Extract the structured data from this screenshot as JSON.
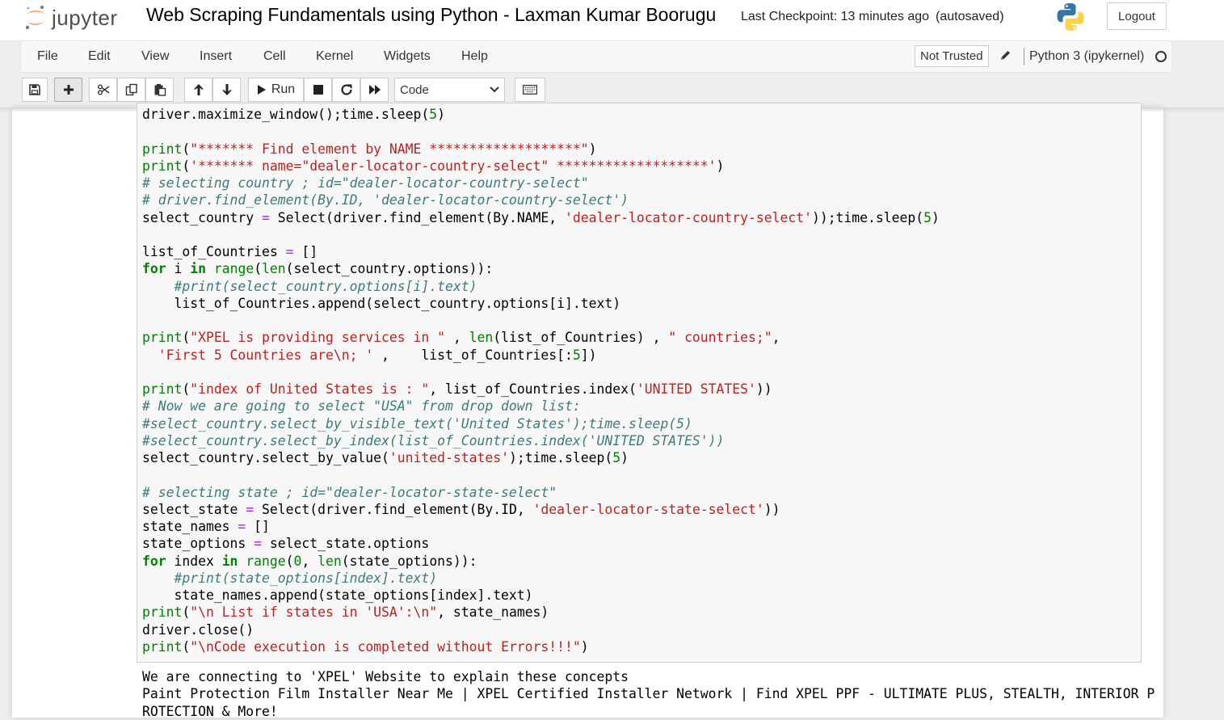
{
  "header": {
    "logo_text": "jupyter",
    "notebook_title": "Web Scraping Fundamentals using Python - Laxman Kumar Boorugu",
    "checkpoint": "Last Checkpoint: 13 minutes ago",
    "autosave": "(autosaved)",
    "logout_label": "Logout"
  },
  "menubar": {
    "items": [
      "File",
      "Edit",
      "View",
      "Insert",
      "Cell",
      "Kernel",
      "Widgets",
      "Help"
    ],
    "not_trusted_label": "Not Trusted",
    "kernel_name": "Python 3 (ipykernel)"
  },
  "toolbar": {
    "run_label": "Run",
    "cell_type": "Code",
    "icons": [
      "save-icon",
      "plus-icon",
      "scissors-icon",
      "copy-icon",
      "paste-icon",
      "arrow-up-icon",
      "arrow-down-icon",
      "step-forward-icon",
      "stop-icon",
      "restart-icon",
      "fast-forward-icon",
      "keyboard-icon"
    ]
  },
  "colors": {
    "keyword": "#008000",
    "string": "#ba2121",
    "comment": "#3d7b7b",
    "operator": "#aa22ff"
  },
  "cell": {
    "code_lines": [
      [
        [
          "n",
          "driver.maximize_window();time.sleep("
        ],
        [
          "num",
          "5"
        ],
        [
          "n",
          ")"
        ]
      ],
      [],
      [
        [
          "bi",
          "print"
        ],
        [
          "n",
          "("
        ],
        [
          "str",
          "\"******* Find element by NAME *******************\""
        ],
        [
          "n",
          ")"
        ]
      ],
      [
        [
          "bi",
          "print"
        ],
        [
          "n",
          "("
        ],
        [
          "str",
          "'******* name=\"dealer-locator-country-select\" *******************'"
        ],
        [
          "n",
          ")"
        ]
      ],
      [
        [
          "cm",
          "# selecting country ; id=\"dealer-locator-country-select\""
        ]
      ],
      [
        [
          "cm",
          "# driver.find_element(By.ID, 'dealer-locator-country-select')"
        ]
      ],
      [
        [
          "n",
          "select_country "
        ],
        [
          "op",
          "="
        ],
        [
          "n",
          " Select(driver.find_element(By.NAME, "
        ],
        [
          "str",
          "'dealer-locator-country-select'"
        ],
        [
          "n",
          "));time.sleep("
        ],
        [
          "num",
          "5"
        ],
        [
          "n",
          ")"
        ]
      ],
      [],
      [
        [
          "n",
          "list_of_Countries "
        ],
        [
          "op",
          "="
        ],
        [
          "n",
          " []"
        ]
      ],
      [
        [
          "kw",
          "for"
        ],
        [
          "n",
          " i "
        ],
        [
          "kw",
          "in"
        ],
        [
          "n",
          " "
        ],
        [
          "bi",
          "range"
        ],
        [
          "n",
          "("
        ],
        [
          "bi",
          "len"
        ],
        [
          "n",
          "(select_country.options)):"
        ]
      ],
      [
        [
          "n",
          "    "
        ],
        [
          "cm",
          "#print(select_country.options[i].text)"
        ]
      ],
      [
        [
          "n",
          "    list_of_Countries.append(select_country.options[i].text)"
        ]
      ],
      [],
      [
        [
          "bi",
          "print"
        ],
        [
          "n",
          "("
        ],
        [
          "str",
          "\"XPEL is providing services in \""
        ],
        [
          "n",
          " , "
        ],
        [
          "bi",
          "len"
        ],
        [
          "n",
          "(list_of_Countries) , "
        ],
        [
          "str",
          "\" countries;\""
        ],
        [
          "n",
          ","
        ]
      ],
      [
        [
          "n",
          "  "
        ],
        [
          "str",
          "'First 5 Countries are\\n; '"
        ],
        [
          "n",
          " ,    list_of_Countries[:"
        ],
        [
          "num",
          "5"
        ],
        [
          "n",
          "])"
        ]
      ],
      [],
      [
        [
          "bi",
          "print"
        ],
        [
          "n",
          "("
        ],
        [
          "str",
          "\"index of United States is : \""
        ],
        [
          "n",
          ", list_of_Countries.index("
        ],
        [
          "str",
          "'UNITED STATES'"
        ],
        [
          "n",
          "))"
        ]
      ],
      [
        [
          "cm",
          "# Now we are going to select \"USA\" from drop down list:"
        ]
      ],
      [
        [
          "cm",
          "#select_country.select_by_visible_text('United States');time.sleep(5)"
        ]
      ],
      [
        [
          "cm",
          "#select_country.select_by_index(list_of_Countries.index('UNITED STATES'))"
        ]
      ],
      [
        [
          "n",
          "select_country.select_by_value("
        ],
        [
          "str",
          "'united-states'"
        ],
        [
          "n",
          ");time.sleep("
        ],
        [
          "num",
          "5"
        ],
        [
          "n",
          ")"
        ]
      ],
      [],
      [
        [
          "cm",
          "# selecting state ; id=\"dealer-locator-state-select\""
        ]
      ],
      [
        [
          "n",
          "select_state "
        ],
        [
          "op",
          "="
        ],
        [
          "n",
          " Select(driver.find_element(By.ID, "
        ],
        [
          "str",
          "'dealer-locator-state-select'"
        ],
        [
          "n",
          "))"
        ]
      ],
      [
        [
          "n",
          "state_names "
        ],
        [
          "op",
          "="
        ],
        [
          "n",
          " []"
        ]
      ],
      [
        [
          "n",
          "state_options "
        ],
        [
          "op",
          "="
        ],
        [
          "n",
          " select_state.options"
        ]
      ],
      [
        [
          "kw",
          "for"
        ],
        [
          "n",
          " index "
        ],
        [
          "kw",
          "in"
        ],
        [
          "n",
          " "
        ],
        [
          "bi",
          "range"
        ],
        [
          "n",
          "("
        ],
        [
          "num",
          "0"
        ],
        [
          "n",
          ", "
        ],
        [
          "bi",
          "len"
        ],
        [
          "n",
          "(state_options)):"
        ]
      ],
      [
        [
          "n",
          "    "
        ],
        [
          "cm",
          "#print(state_options[index].text)"
        ]
      ],
      [
        [
          "n",
          "    state_names.append(state_options[index].text)"
        ]
      ],
      [
        [
          "bi",
          "print"
        ],
        [
          "n",
          "("
        ],
        [
          "str",
          "\"\\n List if states in 'USA':\\n\""
        ],
        [
          "n",
          ", state_names)"
        ]
      ],
      [
        [
          "n",
          "driver.close()"
        ]
      ],
      [
        [
          "bi",
          "print"
        ],
        [
          "n",
          "("
        ],
        [
          "str",
          "\"\\nCode execution is completed without Errors!!!\""
        ],
        [
          "n",
          ")"
        ]
      ]
    ],
    "output_lines": [
      "We are connecting to 'XPEL' Website to explain these concepts",
      "Paint Protection Film Installer Near Me | XPEL Certified Installer Network | Find XPEL PPF - ULTIMATE PLUS, STEALTH, INTERIOR P",
      "ROTECTION & More!"
    ]
  }
}
